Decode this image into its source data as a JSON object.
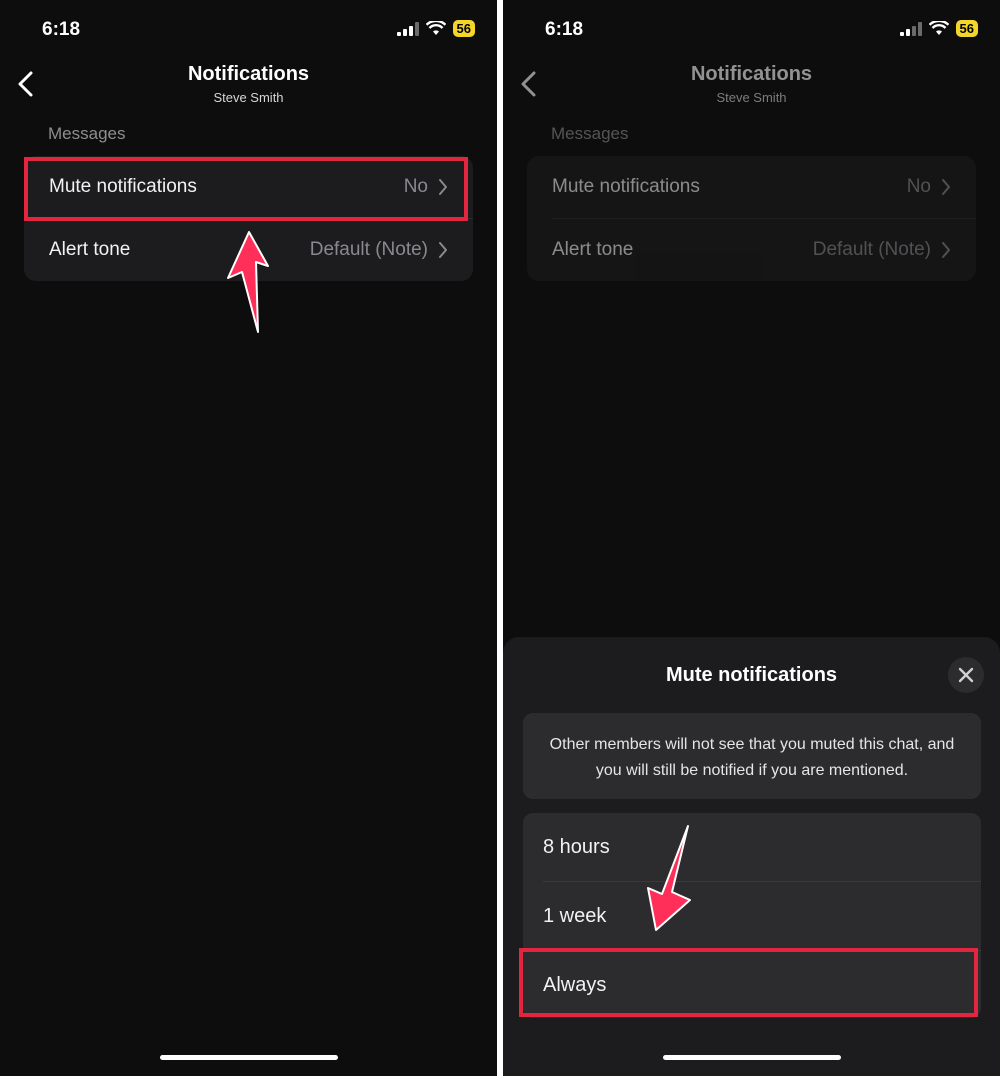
{
  "accent_color": "#e3263f",
  "left_screen": {
    "status": {
      "time": "6:18",
      "battery": "56"
    },
    "nav": {
      "title": "Notifications",
      "subtitle": "Steve Smith"
    },
    "section_label": "Messages",
    "rows": [
      {
        "label": "Mute notifications",
        "value": "No"
      },
      {
        "label": "Alert tone",
        "value": "Default (Note)"
      }
    ]
  },
  "right_screen": {
    "status": {
      "time": "6:18",
      "battery": "56"
    },
    "nav": {
      "title": "Notifications",
      "subtitle": "Steve Smith"
    },
    "section_label": "Messages",
    "rows": [
      {
        "label": "Mute notifications",
        "value": "No"
      },
      {
        "label": "Alert tone",
        "value": "Default (Note)"
      }
    ],
    "sheet": {
      "title": "Mute notifications",
      "info_line1": "Other members will not see that you muted this chat, and",
      "info_line2": "you will still be notified if you are mentioned.",
      "options": [
        "8 hours",
        "1 week",
        "Always"
      ]
    }
  },
  "icons": [
    "back-chevron-icon",
    "chevron-right-icon",
    "close-icon",
    "wifi-icon",
    "cellular-signal-icon",
    "annotation-arrow-icon"
  ]
}
